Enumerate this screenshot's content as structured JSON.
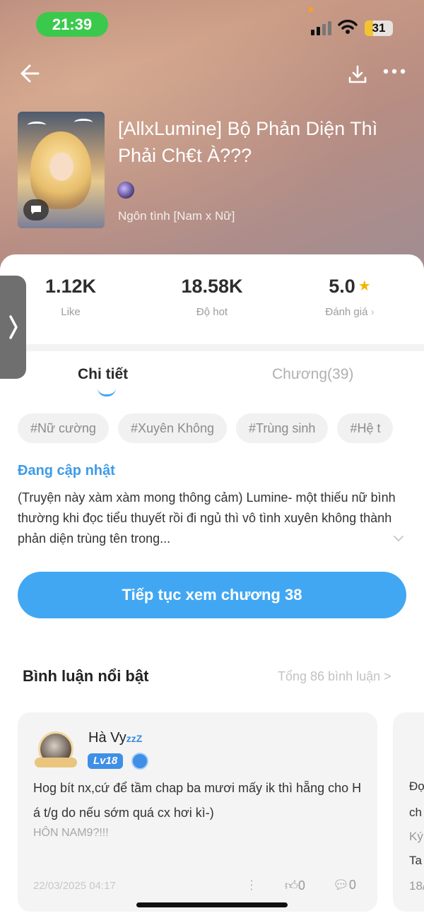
{
  "status_bar": {
    "time": "21:39",
    "battery": "31"
  },
  "book": {
    "title": "[AllxLumine] Bộ Phản Diện Thì Phải Ch€t À???",
    "genre": "Ngôn tình [Nam x Nữ]"
  },
  "stats": [
    {
      "value": "1.12K",
      "label": "Like"
    },
    {
      "value": "18.58K",
      "label": "Độ hot"
    },
    {
      "value": "5.0",
      "label": "Đánh giá"
    }
  ],
  "tabs": {
    "detail": "Chi tiết",
    "chapters": "Chương(39)"
  },
  "tags": [
    "#Nữ cường",
    "#Xuyên Không",
    "#Trùng sinh",
    "#Hệ t"
  ],
  "status_label": "Đang cập nhật",
  "description": "(Truyện này xàm xàm mong thông cảm) Lumine- một thiếu nữ bình thường khi đọc tiểu thuyết rồi đi ngủ thì vô tình xuyên không thành phản diện trùng tên trong...",
  "cta_label": "Tiếp tục xem chương 38",
  "comments": {
    "title": "Bình luận nổi bật",
    "total": "Tổng 86 bình luận >",
    "items": [
      {
        "user": "Hà Vy",
        "user_suffix": "zzZ",
        "level": "Lv18",
        "text": "Hog bít nx,cứ để tầm chap ba mươi mấy ik thì hẵng cho H á t/g do nếu sớm quá cx hơi kì-)",
        "extra": "HÔN NAM9?!!!",
        "date": "22/03/2025 04:17",
        "likes": "0",
        "replies": "0"
      }
    ],
    "next_peek": [
      "Đợ",
      "ch",
      "Ký",
      "Ta",
      "18/"
    ]
  },
  "colors": {
    "accent": "#41a7f3",
    "status_green": "#3bc94d",
    "star": "#f4b400"
  }
}
